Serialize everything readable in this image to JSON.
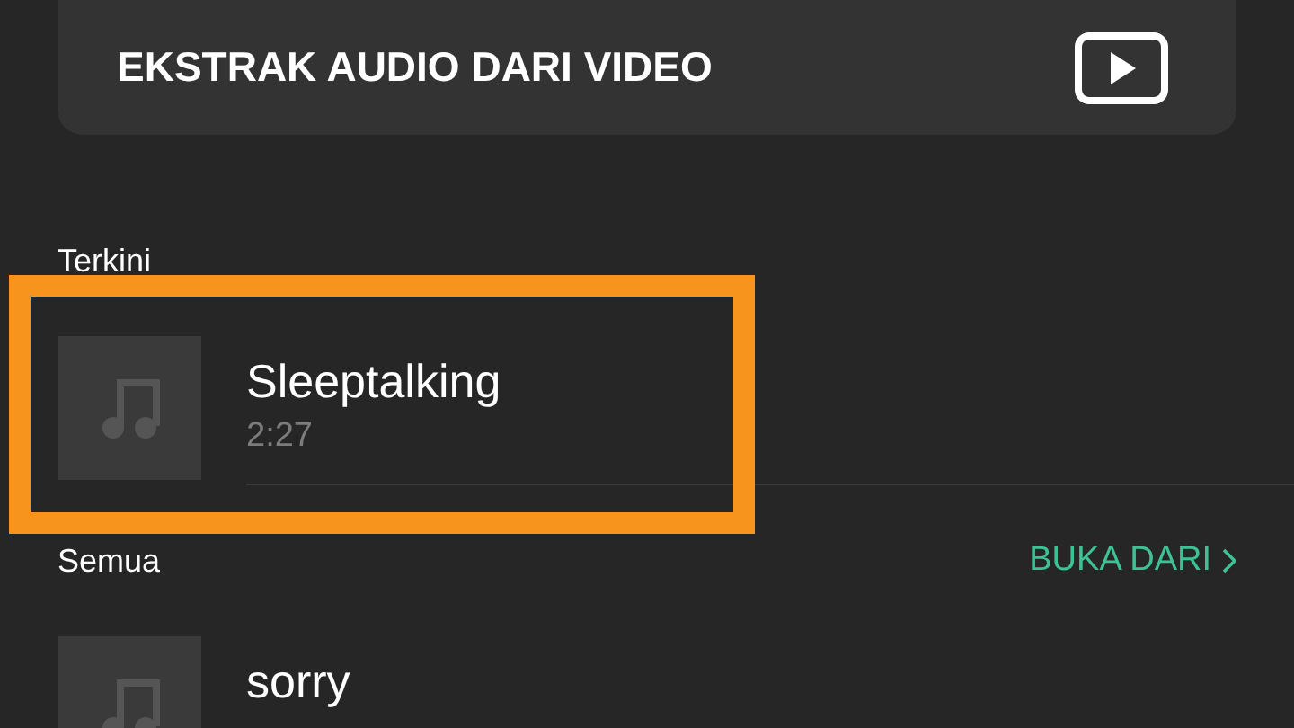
{
  "header_card": {
    "label": "EKSTRAK AUDIO DARI VIDEO"
  },
  "sections": [
    {
      "title": "Terkini",
      "tracks": [
        {
          "title": "Sleeptalking",
          "duration": "2:27",
          "highlighted": true
        }
      ]
    },
    {
      "title": "Semua",
      "action": "BUKA DARI",
      "tracks": [
        {
          "title": "sorry",
          "highlighted": false
        }
      ]
    }
  ]
}
